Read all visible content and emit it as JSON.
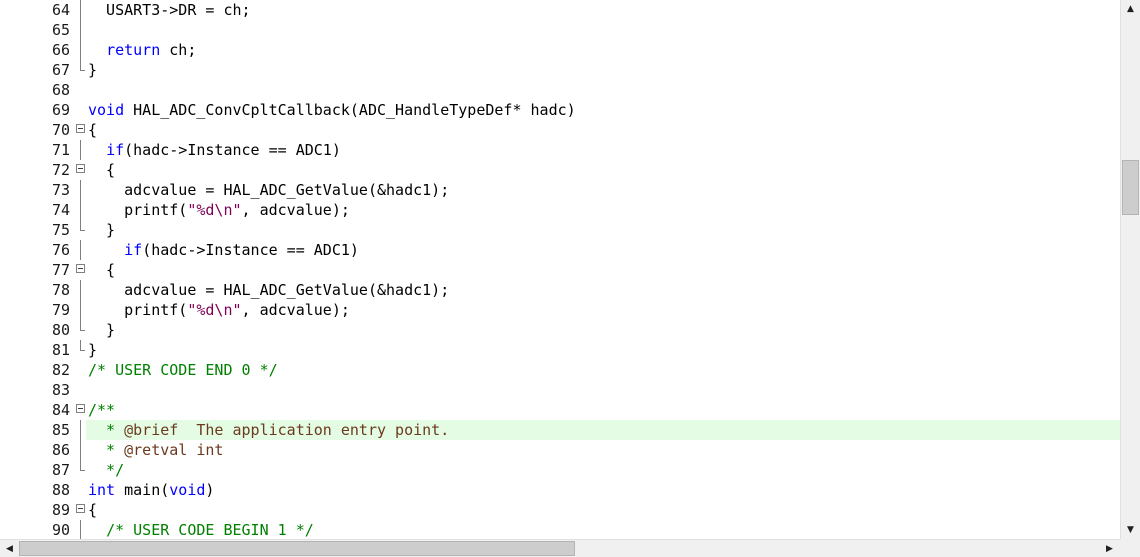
{
  "editor": {
    "highlighted_line": "85",
    "lines": [
      {
        "num": "64",
        "fold": "vline",
        "code": [
          {
            "t": "  USART3->DR = ch;",
            "c": ""
          }
        ]
      },
      {
        "num": "65",
        "fold": "vline",
        "code": []
      },
      {
        "num": "66",
        "fold": "vline",
        "code": [
          {
            "t": "  ",
            "c": ""
          },
          {
            "t": "return",
            "c": "kw"
          },
          {
            "t": " ch;",
            "c": ""
          }
        ]
      },
      {
        "num": "67",
        "fold": "end",
        "code": [
          {
            "t": "}",
            "c": ""
          }
        ]
      },
      {
        "num": "68",
        "fold": "",
        "code": []
      },
      {
        "num": "69",
        "fold": "",
        "code": [
          {
            "t": "void",
            "c": "kw"
          },
          {
            "t": " HAL_ADC_ConvCpltCallback(ADC_HandleTypeDef* hadc)",
            "c": ""
          }
        ]
      },
      {
        "num": "70",
        "fold": "box",
        "code": [
          {
            "t": "{",
            "c": ""
          }
        ]
      },
      {
        "num": "71",
        "fold": "vline",
        "code": [
          {
            "t": "  ",
            "c": ""
          },
          {
            "t": "if",
            "c": "kw"
          },
          {
            "t": "(hadc->Instance == ADC1)",
            "c": ""
          }
        ]
      },
      {
        "num": "72",
        "fold": "box",
        "code": [
          {
            "t": "  {",
            "c": ""
          }
        ]
      },
      {
        "num": "73",
        "fold": "vline",
        "code": [
          {
            "t": "    adcvalue = HAL_ADC_GetValue(&hadc1);",
            "c": ""
          }
        ]
      },
      {
        "num": "74",
        "fold": "vline",
        "code": [
          {
            "t": "    printf(",
            "c": ""
          },
          {
            "t": "\"%d\\n\"",
            "c": "str"
          },
          {
            "t": ", adcvalue);",
            "c": ""
          }
        ]
      },
      {
        "num": "75",
        "fold": "end",
        "code": [
          {
            "t": "  }",
            "c": ""
          }
        ]
      },
      {
        "num": "76",
        "fold": "vline",
        "code": [
          {
            "t": "    ",
            "c": ""
          },
          {
            "t": "if",
            "c": "kw"
          },
          {
            "t": "(hadc->Instance == ADC1)",
            "c": ""
          }
        ]
      },
      {
        "num": "77",
        "fold": "box",
        "code": [
          {
            "t": "  {",
            "c": ""
          }
        ]
      },
      {
        "num": "78",
        "fold": "vline",
        "code": [
          {
            "t": "    adcvalue = HAL_ADC_GetValue(&hadc1);",
            "c": ""
          }
        ]
      },
      {
        "num": "79",
        "fold": "vline",
        "code": [
          {
            "t": "    printf(",
            "c": ""
          },
          {
            "t": "\"%d\\n\"",
            "c": "str"
          },
          {
            "t": ", adcvalue);",
            "c": ""
          }
        ]
      },
      {
        "num": "80",
        "fold": "end",
        "code": [
          {
            "t": "  }",
            "c": ""
          }
        ]
      },
      {
        "num": "81",
        "fold": "end",
        "code": [
          {
            "t": "}",
            "c": ""
          }
        ]
      },
      {
        "num": "82",
        "fold": "",
        "code": [
          {
            "t": "/* USER CODE END 0 */",
            "c": "cm"
          }
        ]
      },
      {
        "num": "83",
        "fold": "",
        "code": []
      },
      {
        "num": "84",
        "fold": "box",
        "code": [
          {
            "t": "/**",
            "c": "cm"
          }
        ]
      },
      {
        "num": "85",
        "fold": "vline",
        "code": [
          {
            "t": "  * ",
            "c": "cm"
          },
          {
            "t": "@brief  The application entry point.",
            "c": "doc"
          }
        ]
      },
      {
        "num": "86",
        "fold": "vline",
        "code": [
          {
            "t": "  * ",
            "c": "cm"
          },
          {
            "t": "@retval int",
            "c": "doc"
          }
        ]
      },
      {
        "num": "87",
        "fold": "end",
        "code": [
          {
            "t": "  */",
            "c": "cm"
          }
        ]
      },
      {
        "num": "88",
        "fold": "",
        "code": [
          {
            "t": "int",
            "c": "kw"
          },
          {
            "t": " main(",
            "c": ""
          },
          {
            "t": "void",
            "c": "kw"
          },
          {
            "t": ")",
            "c": ""
          }
        ]
      },
      {
        "num": "89",
        "fold": "box",
        "code": [
          {
            "t": "{",
            "c": ""
          }
        ]
      },
      {
        "num": "90",
        "fold": "vline",
        "code": [
          {
            "t": "  ",
            "c": ""
          },
          {
            "t": "/* USER CODE BEGIN 1 */",
            "c": "cm"
          }
        ]
      }
    ]
  },
  "scrollbars": {
    "up_arrow": "▲",
    "down_arrow": "▼",
    "left_arrow": "◀",
    "right_arrow": "▶"
  },
  "colors": {
    "keyword": "#0000ff",
    "comment": "#008000",
    "string": "#7f0055",
    "highlight": "#e3fce3"
  }
}
